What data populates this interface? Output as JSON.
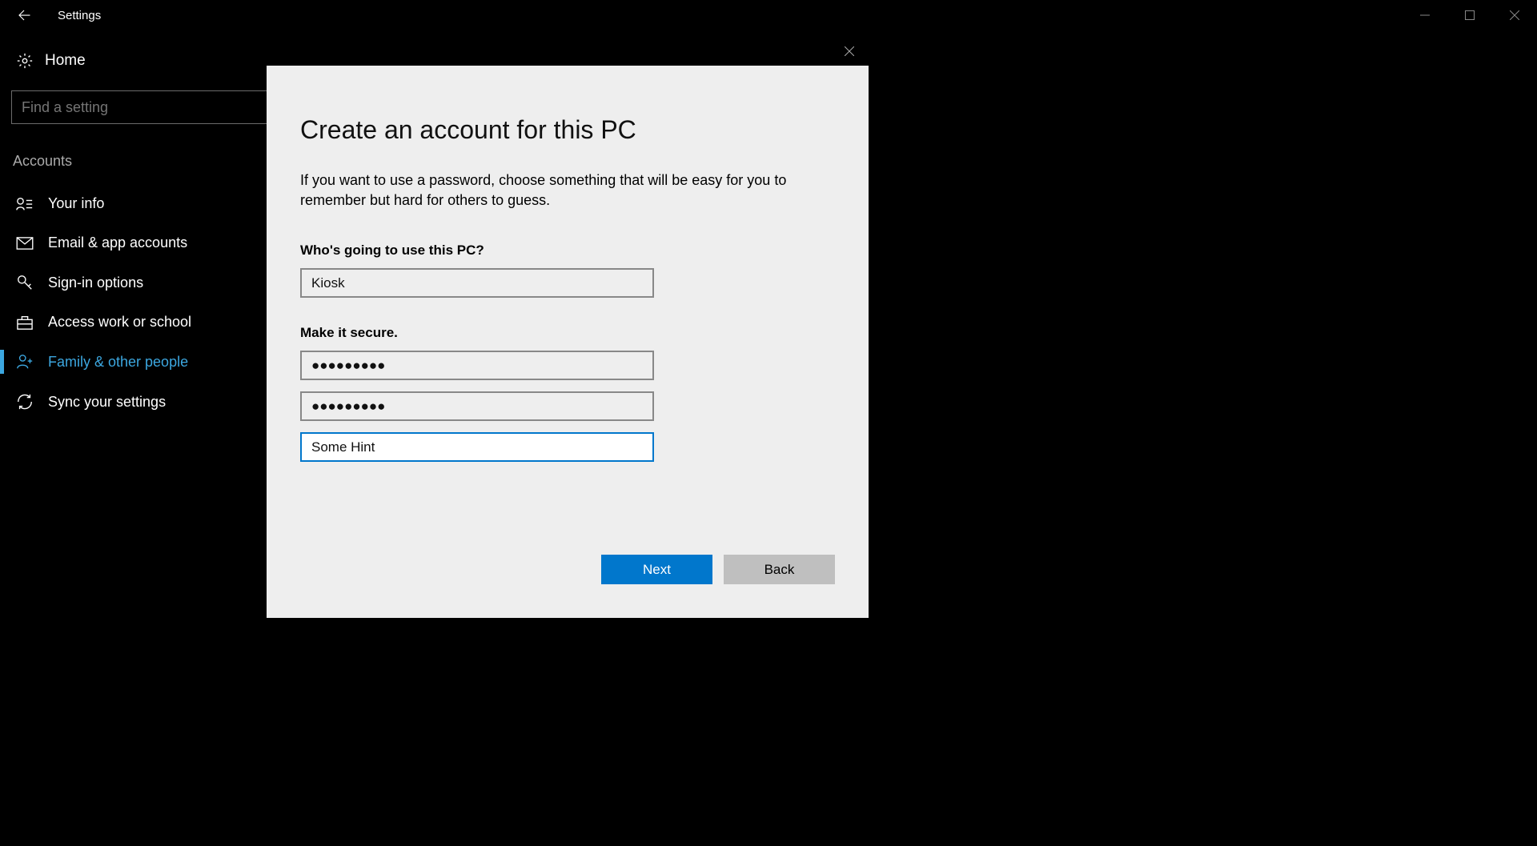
{
  "window": {
    "title": "Settings"
  },
  "sidebar": {
    "home_label": "Home",
    "search_placeholder": "Find a setting",
    "section_header": "Accounts",
    "items": [
      {
        "label": "Your info"
      },
      {
        "label": "Email & app accounts"
      },
      {
        "label": "Sign-in options"
      },
      {
        "label": "Access work or school"
      },
      {
        "label": "Family & other people"
      },
      {
        "label": "Sync your settings"
      }
    ]
  },
  "dialog": {
    "title": "Create an account for this PC",
    "description": "If you want to use a password, choose something that will be easy for you to remember but hard for others to guess.",
    "user_section_label": "Who's going to use this PC?",
    "username_value": "Kiosk",
    "secure_section_label": "Make it secure.",
    "password_value": "●●●●●●●●●",
    "password_confirm_value": "●●●●●●●●●",
    "hint_value": "Some Hint",
    "next_label": "Next",
    "back_label": "Back"
  }
}
